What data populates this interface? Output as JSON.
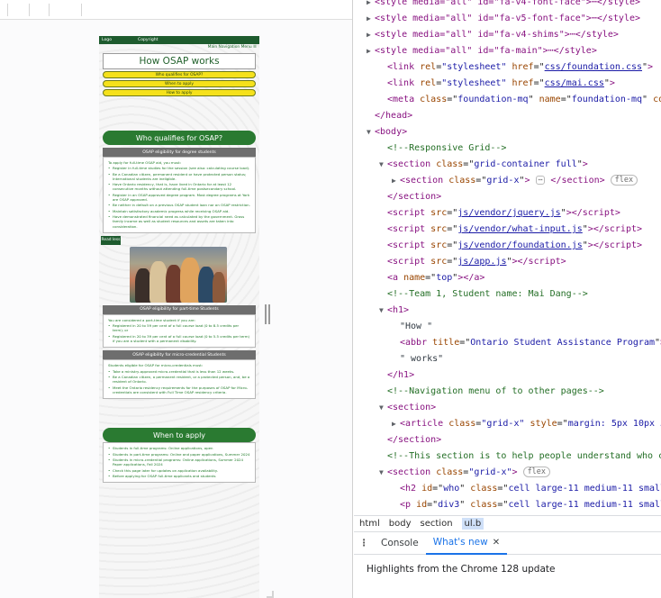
{
  "viewport": {
    "nav": {
      "logo": "Logo",
      "copyright": "Copyright",
      "main_menu": "Main Navigation Menu ☰"
    },
    "title": "How OSAP works",
    "pills": [
      "Who qualifies for OSAP?",
      "When to apply",
      "How to apply"
    ],
    "who_heading": "Who qualifies for OSAP?",
    "degree": {
      "heading": "OSAP eligibility for degree students",
      "intro": "To apply for full-time OSAP aid, you must:",
      "items": [
        "Register in full-time studies for the session (see also: calculating course load).",
        "Be a Canadian citizen, permanent resident or have protected person status; International students are ineligible.",
        "Have Ontario residency, that is, have lived in Ontario for at least 12 consecutive months without attending full-time postsecondary school.",
        "Register in an OSAP-approved degree program. Most degree programs at York are OSAP approved.",
        "Be neither in default on a previous OSAP student loan nor on OSAP restriction.",
        "Maintain satisfactory academic progress while receiving OSAP aid.",
        "Have demonstrated financial need as calculated by the government. Gross family income as well as student resources and assets are taken into consideration."
      ]
    },
    "read_less": "Read less",
    "part_time": {
      "heading": "OSAP eligibility for part-time Students",
      "intro": "You are considered a part-time student if you are:",
      "items": [
        "Registered in 20 to 59 per cent of a full course load (0 to 8.5 credits per term); or",
        "Registered in 20 to 39 per cent of a full course load (0 to 5.5 credits per term) if you are a student with a permanent disability."
      ]
    },
    "micro": {
      "heading": "OSAP eligibility for micro-credential Students",
      "intro": "Students eligible for OSAP for micro-credentials must:",
      "items": [
        "Take a ministry-approved micro-credential that is less than 12 weeks.",
        "Be a Canadian citizen, a permanent resident, or a protected person, and, be a resident of Ontario.",
        "Meet the Ontario residency requirements for the purposes of OSAP for Micro-credentials are consistent with Full Time OSAP residency criteria."
      ]
    },
    "when": {
      "heading": "When to apply",
      "items": [
        "Students in full-time programs: Online applications, open",
        "Students in part-time programs: Online and paper applications, Summer 2024",
        "Students in micro-credential programs: Online applications, Summer 2024 Paper applications, Fall 2024",
        "Check this page later for updates on application availability.",
        "Before applying for OSAP full-time applicants and students"
      ]
    }
  },
  "devtools": {
    "lines": [
      {
        "t": "style",
        "text": "<style media=\"all\" id=\"fa-v4-font-face\">⋯</style>"
      },
      {
        "t": "style",
        "text": "<style media=\"all\" id=\"fa-v5-font-face\">⋯</style>"
      },
      {
        "t": "style",
        "text": "<style media=\"all\" id=\"fa-v4-shims\">⋯</style>"
      },
      {
        "t": "style",
        "text": "<style media=\"all\" id=\"fa-main\">⋯</style>"
      }
    ],
    "link1_href": "css/foundation.css",
    "link2_href": "css/mai.css",
    "meta_class": "foundation-mq",
    "meta_name": "foundation-mq",
    "comment_grid": "<!--Responsive Grid-->",
    "section_class": "grid-container full",
    "inner_section_class": "grid-x",
    "flex_badge": "flex",
    "scripts": [
      "js/vendor/jquery.js",
      "js/vendor/what-input.js",
      "js/vendor/foundation.js",
      "js/app.js"
    ],
    "anchor_name": "top",
    "comment_team": "<!--Team 1, Student name: Mai Dang-->",
    "h1_text1": "\"How \"",
    "abbr_title": "Ontario Student Assistance Program",
    "h1_text2": "\" works\"",
    "comment_nav": "<!--Navigation menu of to other pages-->",
    "article_style": "margin: 5px 10px 5",
    "comment_help": "<!--This section is to help people understand who c",
    "h2_id": "who",
    "h2_class": "cell large-11 medium-11 small",
    "p_id": "div3",
    "p_class": "cell large-11 medium-11 small",
    "h3_text": "OSAP eligibility for degree students",
    "ul_class": "b",
    "ul_style": "color: green;",
    "selected_marker": "== $0",
    "breadcrumbs": [
      "html",
      "body",
      "section",
      "ul.b"
    ],
    "drawer_tabs": [
      "Console",
      "What's new"
    ],
    "highlights": "Highlights from the Chrome 128 update"
  }
}
